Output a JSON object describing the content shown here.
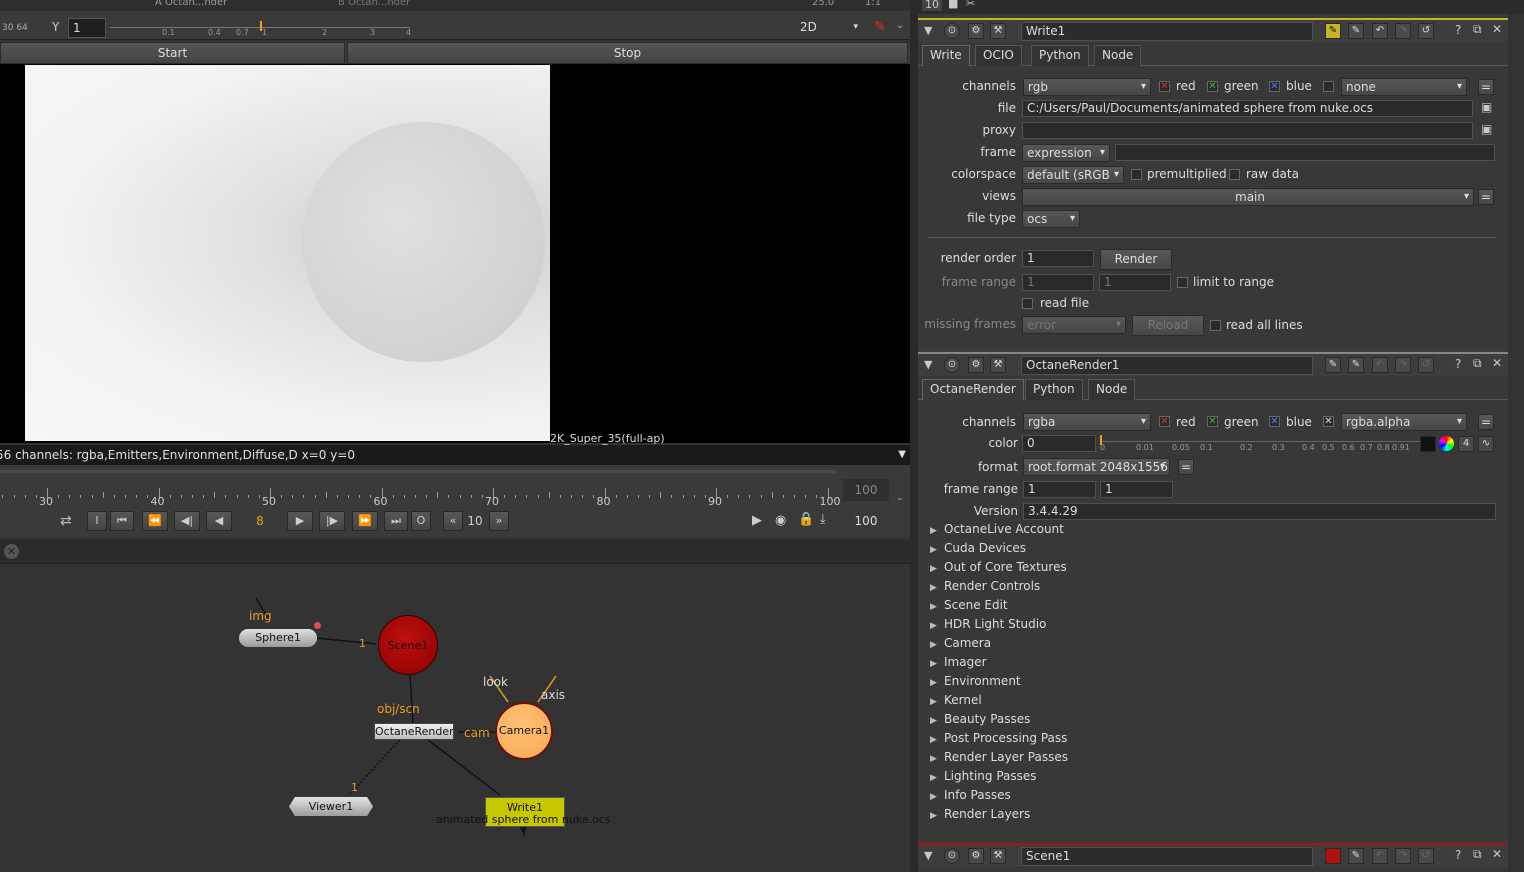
{
  "viewer": {
    "input_a": "Octan...nder",
    "input_b": "Octan...nder",
    "fps": "25.0",
    "ratio": "1:1",
    "y_label": "Y",
    "y_value": "1",
    "gain_ticks": [
      "0.1",
      "0.4",
      "0.7",
      "1",
      "2",
      "3",
      "4"
    ],
    "ruler_left": "30 64",
    "view_mode": "2D",
    "start_label": "Start",
    "stop_label": "Stop",
    "format_label": "2K_Super_35(full-ap)",
    "info_text": "56 channels: rgba,Emitters,Environment,Diffuse,D  x=0 y=0",
    "timeline_ticks": [
      "30",
      "40",
      "50",
      "60",
      "70",
      "80",
      "90",
      "100"
    ],
    "end_frame_top": "100",
    "end_frame": "100",
    "current_frame": "8",
    "step": "10",
    "btn_i": "I",
    "btn_o": "O"
  },
  "nodes": {
    "sphere": "Sphere1",
    "scene": "Scene1",
    "octane": "OctaneRender1",
    "camera": "Camera1",
    "viewer": "Viewer1",
    "write": "Write1",
    "write_sub": "animated sphere from nuke.ocs",
    "img": "img",
    "objscn": "obj/scn",
    "cam": "cam",
    "look": "look",
    "axis": "axis",
    "edge1": "1",
    "edge_viewer": "1"
  },
  "write_panel": {
    "name": "Write1",
    "tabs": [
      "Write",
      "OCIO",
      "Python",
      "Node"
    ],
    "channels_label": "channels",
    "channels_value": "rgb",
    "red": "red",
    "green": "green",
    "blue": "blue",
    "extra_channel": "none",
    "file_label": "file",
    "file_value": "C:/Users/Paul/Documents/animated sphere from nuke.ocs",
    "proxy_label": "proxy",
    "frame_label": "frame",
    "frame_value": "expression",
    "colorspace_label": "colorspace",
    "colorspace_value": "default (sRGB",
    "premultiplied": "premultiplied",
    "raw_data": "raw data",
    "views_label": "views",
    "views_value": "main",
    "filetype_label": "file type",
    "filetype_value": "ocs",
    "render_order_label": "render order",
    "render_order_value": "1",
    "render_btn": "Render",
    "frame_range_label": "frame range",
    "frame_range_a": "1",
    "frame_range_b": "1",
    "limit_to_range": "limit to range",
    "read_file": "read file",
    "missing_frames_label": "missing frames",
    "missing_frames_value": "error",
    "reload_btn": "Reload",
    "read_all_lines": "read all lines"
  },
  "octane_panel": {
    "name": "OctaneRender1",
    "tabs": [
      "OctaneRender",
      "Python",
      "Node"
    ],
    "channels_label": "channels",
    "channels_value": "rgba",
    "red": "red",
    "green": "green",
    "blue": "blue",
    "alpha_value": "rgba.alpha",
    "color_label": "color",
    "color_value": "0",
    "color_ticks": [
      "0",
      "0.01",
      "0.05",
      "0.1",
      "0.2",
      "0.3",
      "0.4",
      "0.5",
      "0.6",
      "0.7",
      "0.8",
      "0.91"
    ],
    "color_count": "4",
    "format_label": "format",
    "format_value": "root.format 2048x1556",
    "frame_range_label": "frame range",
    "frame_range_a": "1",
    "frame_range_b": "1",
    "version_label": "Version",
    "version_value": "3.4.4.29",
    "groups": [
      "OctaneLive Account",
      "Cuda Devices",
      "Out of Core Textures",
      "Render Controls",
      "Scene Edit",
      "HDR Light Studio",
      "Camera",
      "Imager",
      "Environment",
      "Kernel",
      "Beauty Passes",
      "Post Processing Pass",
      "Render Layer Passes",
      "Lighting Passes",
      "Info Passes",
      "Render Layers"
    ]
  },
  "scene_panel": {
    "name": "Scene1"
  },
  "top_right": {
    "count": "10"
  },
  "colors": {
    "write_accent": "#c9b428",
    "scene_accent": "#b01010",
    "camera_fill": "#ffb463",
    "write_node": "#c8c800"
  }
}
